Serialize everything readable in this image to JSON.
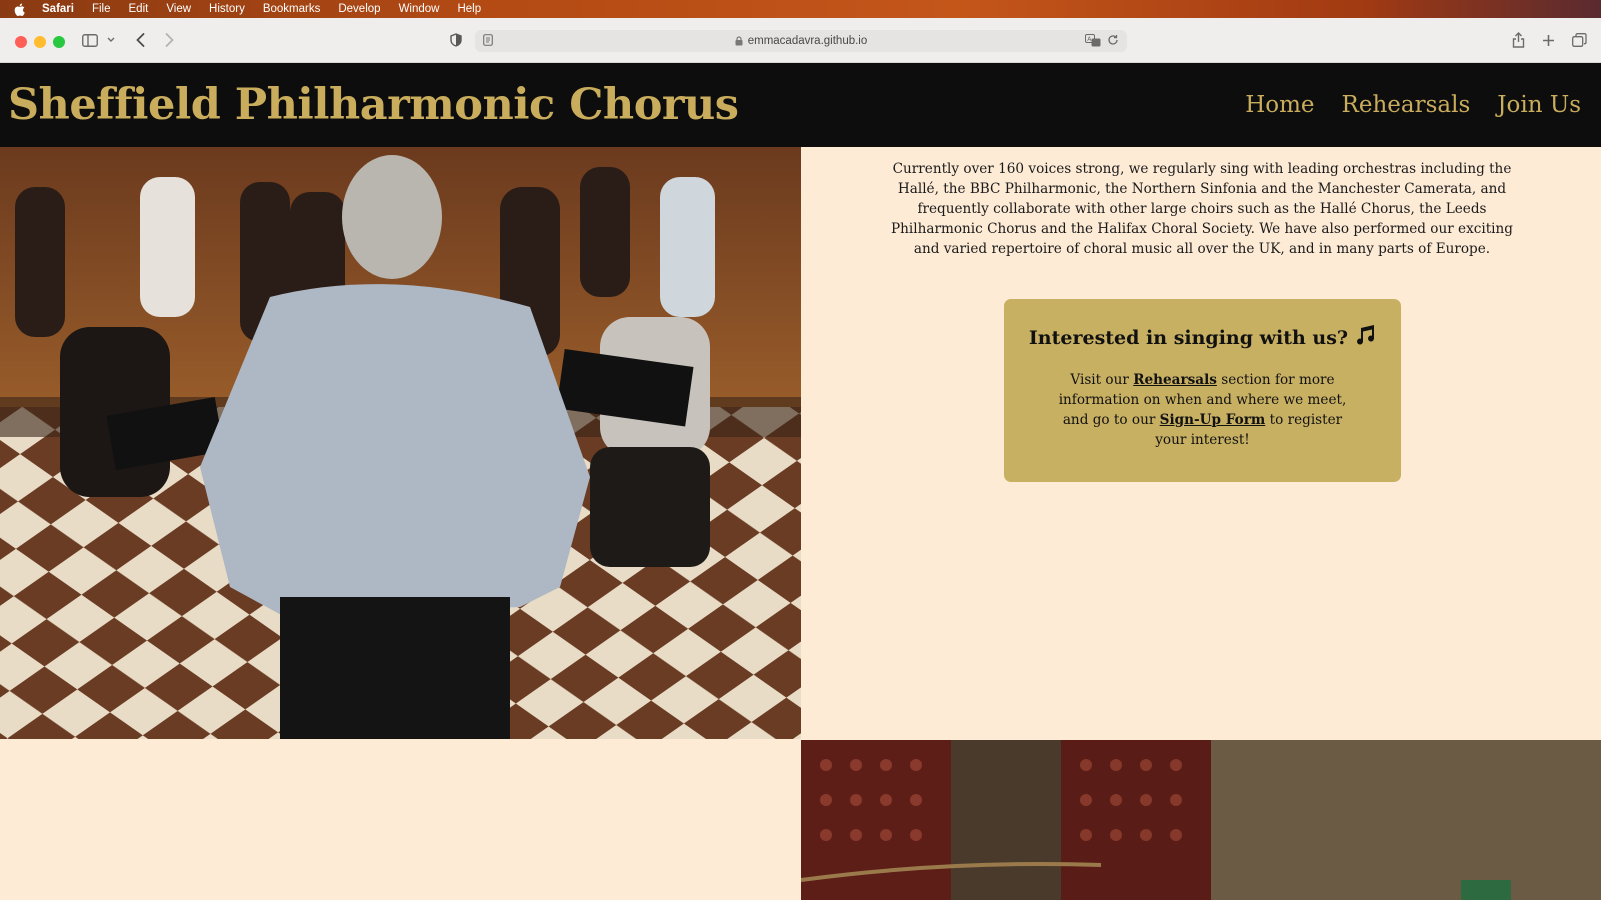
{
  "menubar": {
    "app": "Safari",
    "items": [
      "File",
      "Edit",
      "View",
      "History",
      "Bookmarks",
      "Develop",
      "Window",
      "Help"
    ]
  },
  "browser": {
    "url": "emmacadavra.github.io"
  },
  "site": {
    "title": "Sheffield Philharmonic Chorus",
    "nav": [
      "Home",
      "Rehearsals",
      "Join Us"
    ],
    "accent_color": "#c9ad5c",
    "header_bg": "#0d0d0d",
    "page_bg": "#fdebd6"
  },
  "intro": {
    "text": "Currently over 160 voices strong, we regularly sing with leading orchestras including the Hallé, the BBC Philharmonic, the Northern Sinfonia and the Manchester Camerata, and frequently collaborate with other large choirs such as the Hallé Chorus, the Leeds Philharmonic Chorus and the Halifax Choral Society. We have also performed our exciting and varied repertoire of choral music all over the UK, and in many parts of Europe."
  },
  "callout": {
    "heading": "Interested in singing with us?",
    "icon": "music-notes-icon",
    "text_1": "Visit our ",
    "link_1": "Rehearsals",
    "text_2": " section for more information on when and where we meet, and go to our ",
    "link_2": "Sign-Up Form",
    "text_3": " to register your interest!",
    "bg_color": "#c8b063"
  }
}
